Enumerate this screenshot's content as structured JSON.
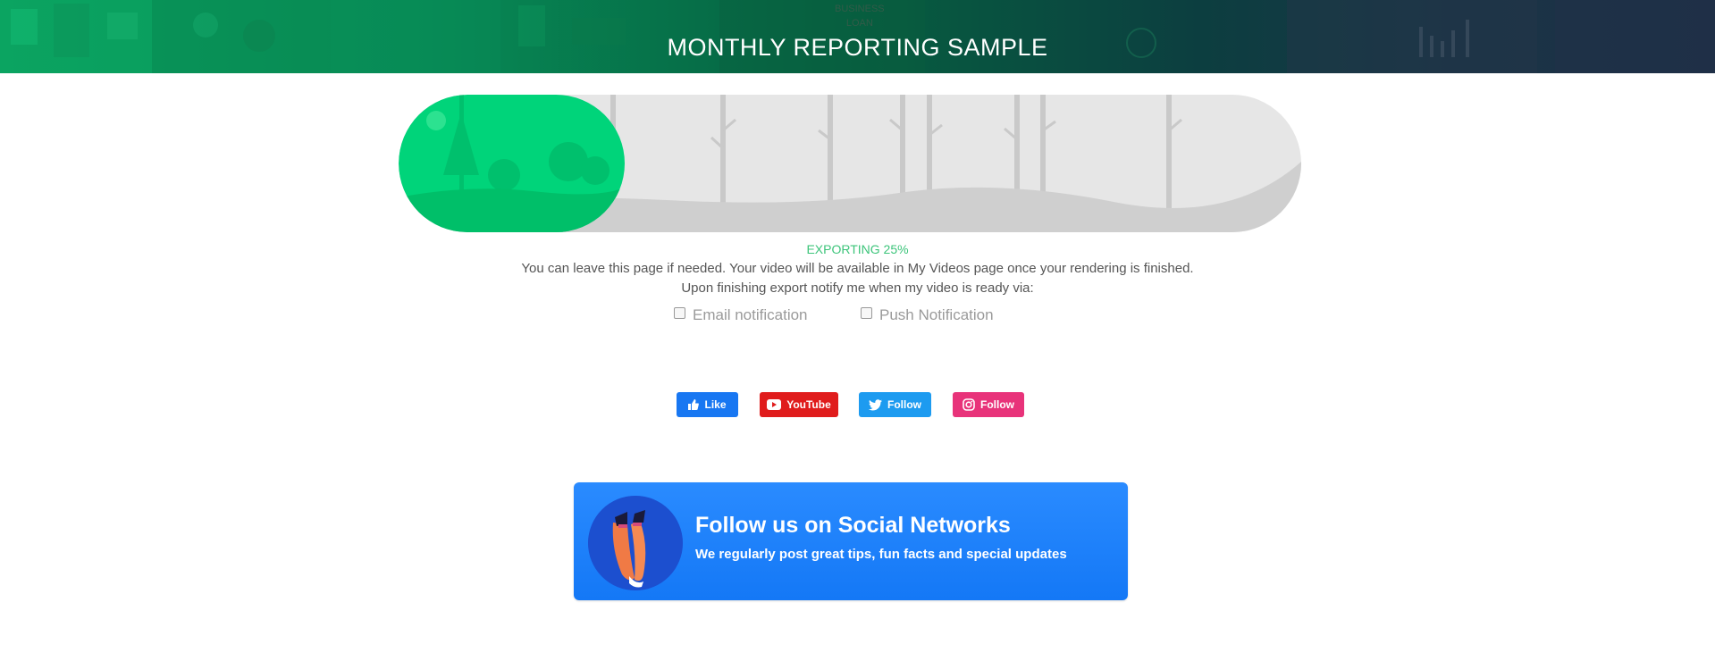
{
  "header": {
    "title": "MONTHLY REPORTING SAMPLE",
    "background_text": [
      "BUSINESS",
      "LOAN"
    ]
  },
  "progress": {
    "label": "EXPORTING 25%",
    "percent": 25,
    "fill_color": "#00d47a",
    "track_color": "#e6e6e6"
  },
  "info": {
    "line1": "You can leave this page if needed. Your video will be available in My Videos page once your rendering is finished.",
    "line2": "Upon finishing export notify me when my video is ready via:"
  },
  "notifications": {
    "email_label": "Email notification",
    "email_checked": false,
    "push_label": "Push Notification",
    "push_checked": false
  },
  "social": {
    "facebook": {
      "label": "Like",
      "color": "#1877f2",
      "icon": "thumbs-up-icon"
    },
    "youtube": {
      "label": "YouTube",
      "color": "#e01c1c",
      "icon": "youtube-play-icon"
    },
    "twitter": {
      "label": "Follow",
      "color": "#1d9bf0",
      "icon": "twitter-bird-icon"
    },
    "instagram": {
      "label": "Follow",
      "color": "#e8337a",
      "icon": "instagram-icon"
    }
  },
  "follow_card": {
    "heading": "Follow us on Social Networks",
    "subheading": "We regularly post great tips, fun facts and special updates",
    "color": "#1478f6"
  }
}
